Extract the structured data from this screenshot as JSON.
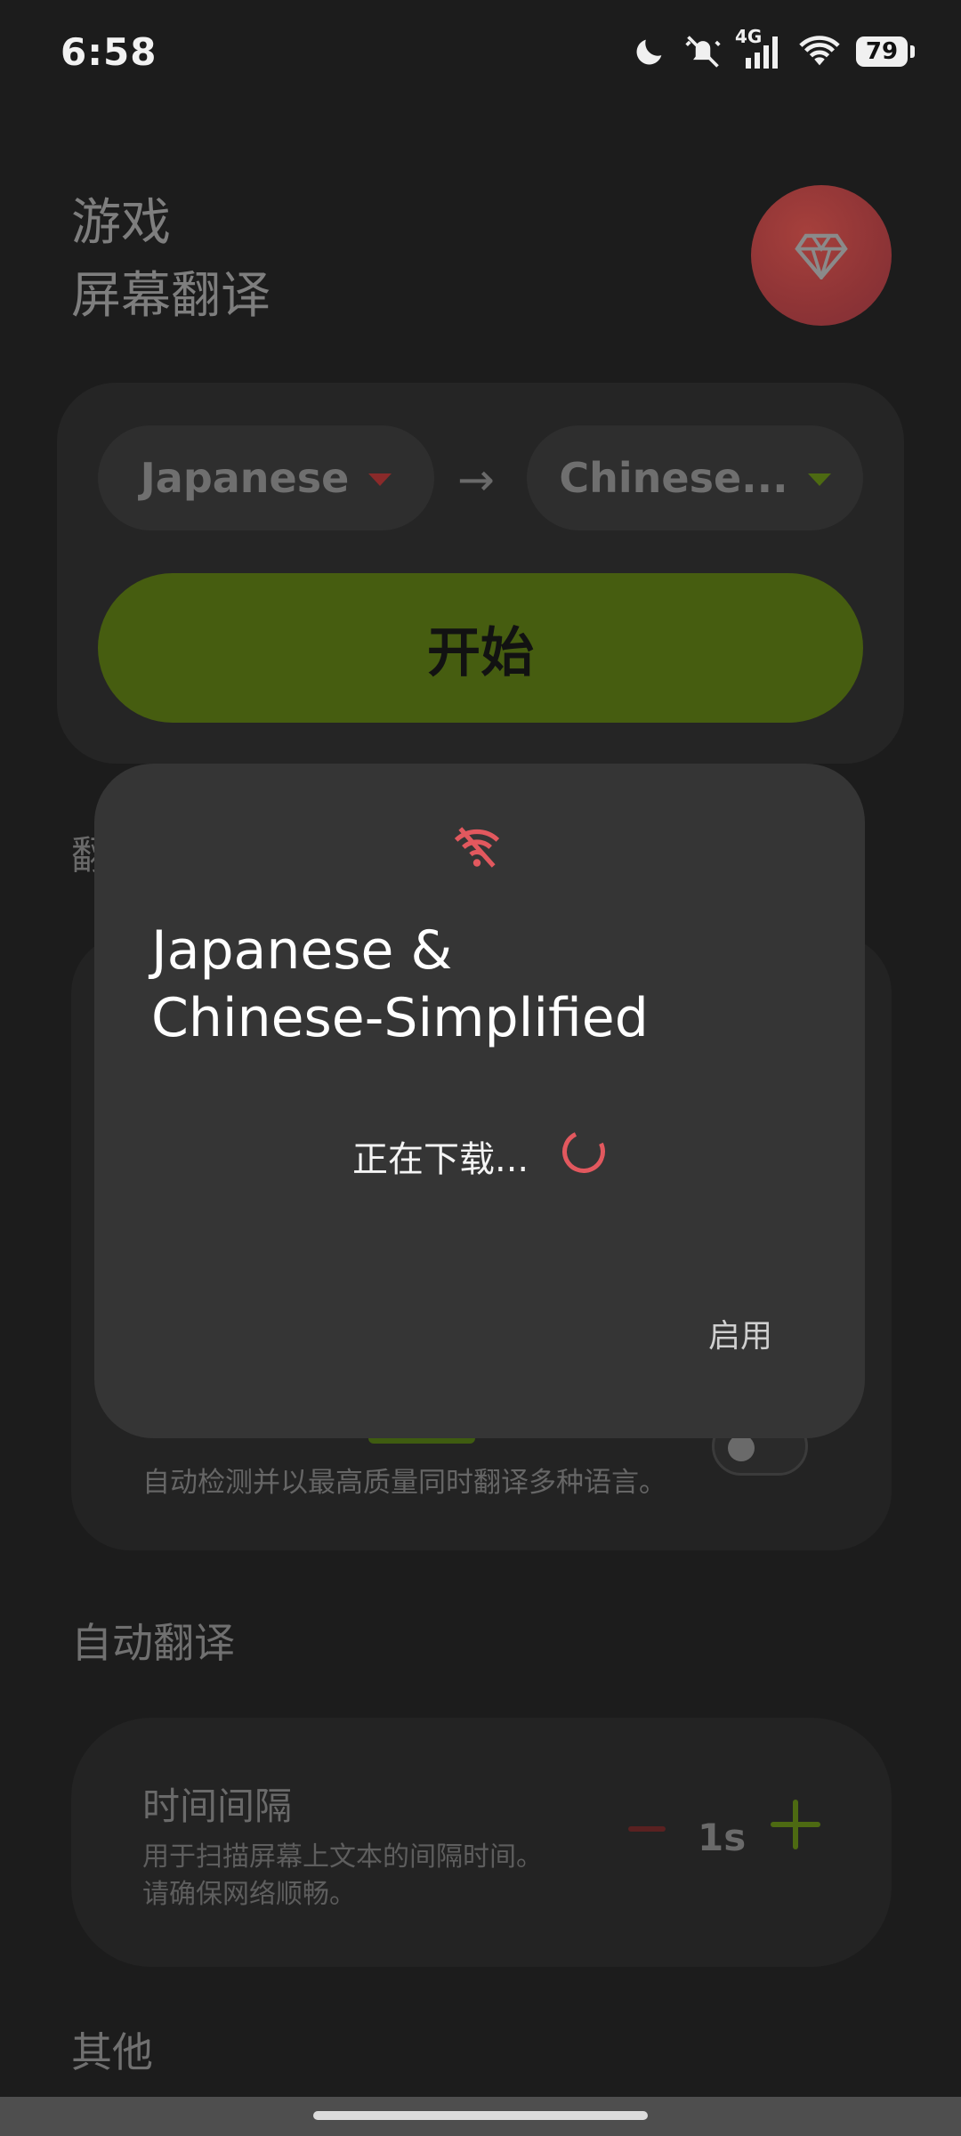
{
  "status_bar": {
    "time": "6:58",
    "network": "4G",
    "battery": "79"
  },
  "header": {
    "title_line1": "游戏",
    "title_line2": "屏幕翻译",
    "premium_icon": "gem-icon"
  },
  "language_selector": {
    "source_language": "Japanese",
    "target_language": "Chinese...",
    "arrow_icon": "arrow-right-icon"
  },
  "start_button": {
    "label": "开始"
  },
  "section_translation": {
    "visible_fragment": "翻"
  },
  "multi_language_card": {
    "description": "自动检测并以最高质量同时翻译多种语言。",
    "toggle_on": false
  },
  "section_auto": {
    "title": "自动翻译"
  },
  "interval_card": {
    "title": "时间间隔",
    "description_line1": "用于扫描屏幕上文本的间隔时间。",
    "description_line2": "请确保网络顺畅。",
    "value": "1s"
  },
  "section_other": {
    "title": "其他"
  },
  "dialog": {
    "icon": "wifi-off-icon",
    "title_line1": "Japanese &",
    "title_line2": "Chinese-Simplified",
    "status": "正在下载...",
    "enable_label": "启用"
  },
  "colors": {
    "accent_green": "#465d10",
    "accent_red": "#e2585e",
    "dialog_bg": "#353535",
    "page_bg": "#1c1c1c"
  }
}
